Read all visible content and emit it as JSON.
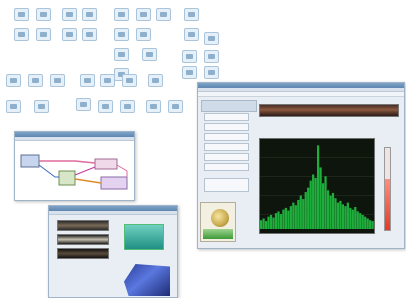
{
  "palette": {
    "icons": [
      "instrument-io-icon",
      "acquire-icon",
      "analysis-icon",
      "signal-icon",
      "math-icon",
      "file-io-icon",
      "timing-icon",
      "graph-icon",
      "waveform-icon",
      "control-icon",
      "string-icon",
      "array-icon",
      "cluster-icon",
      "numeric-icon",
      "boolean-icon",
      "comparison-icon",
      "structure-icon",
      "express-icon"
    ]
  },
  "main_window": {
    "meter_level": 0.62,
    "colors": {
      "spectrum": "#1fae3c",
      "meter": "#e23b2b",
      "waterfall": "#8d5a3f"
    }
  },
  "chart_data": {
    "type": "bar",
    "values": [
      10,
      12,
      9,
      14,
      16,
      13,
      18,
      20,
      17,
      22,
      24,
      21,
      26,
      30,
      27,
      33,
      38,
      34,
      42,
      47,
      55,
      62,
      58,
      95,
      70,
      52,
      60,
      44,
      38,
      41,
      35,
      30,
      32,
      28,
      26,
      30,
      24,
      22,
      25,
      20,
      18,
      16,
      14,
      12,
      10,
      9
    ]
  }
}
